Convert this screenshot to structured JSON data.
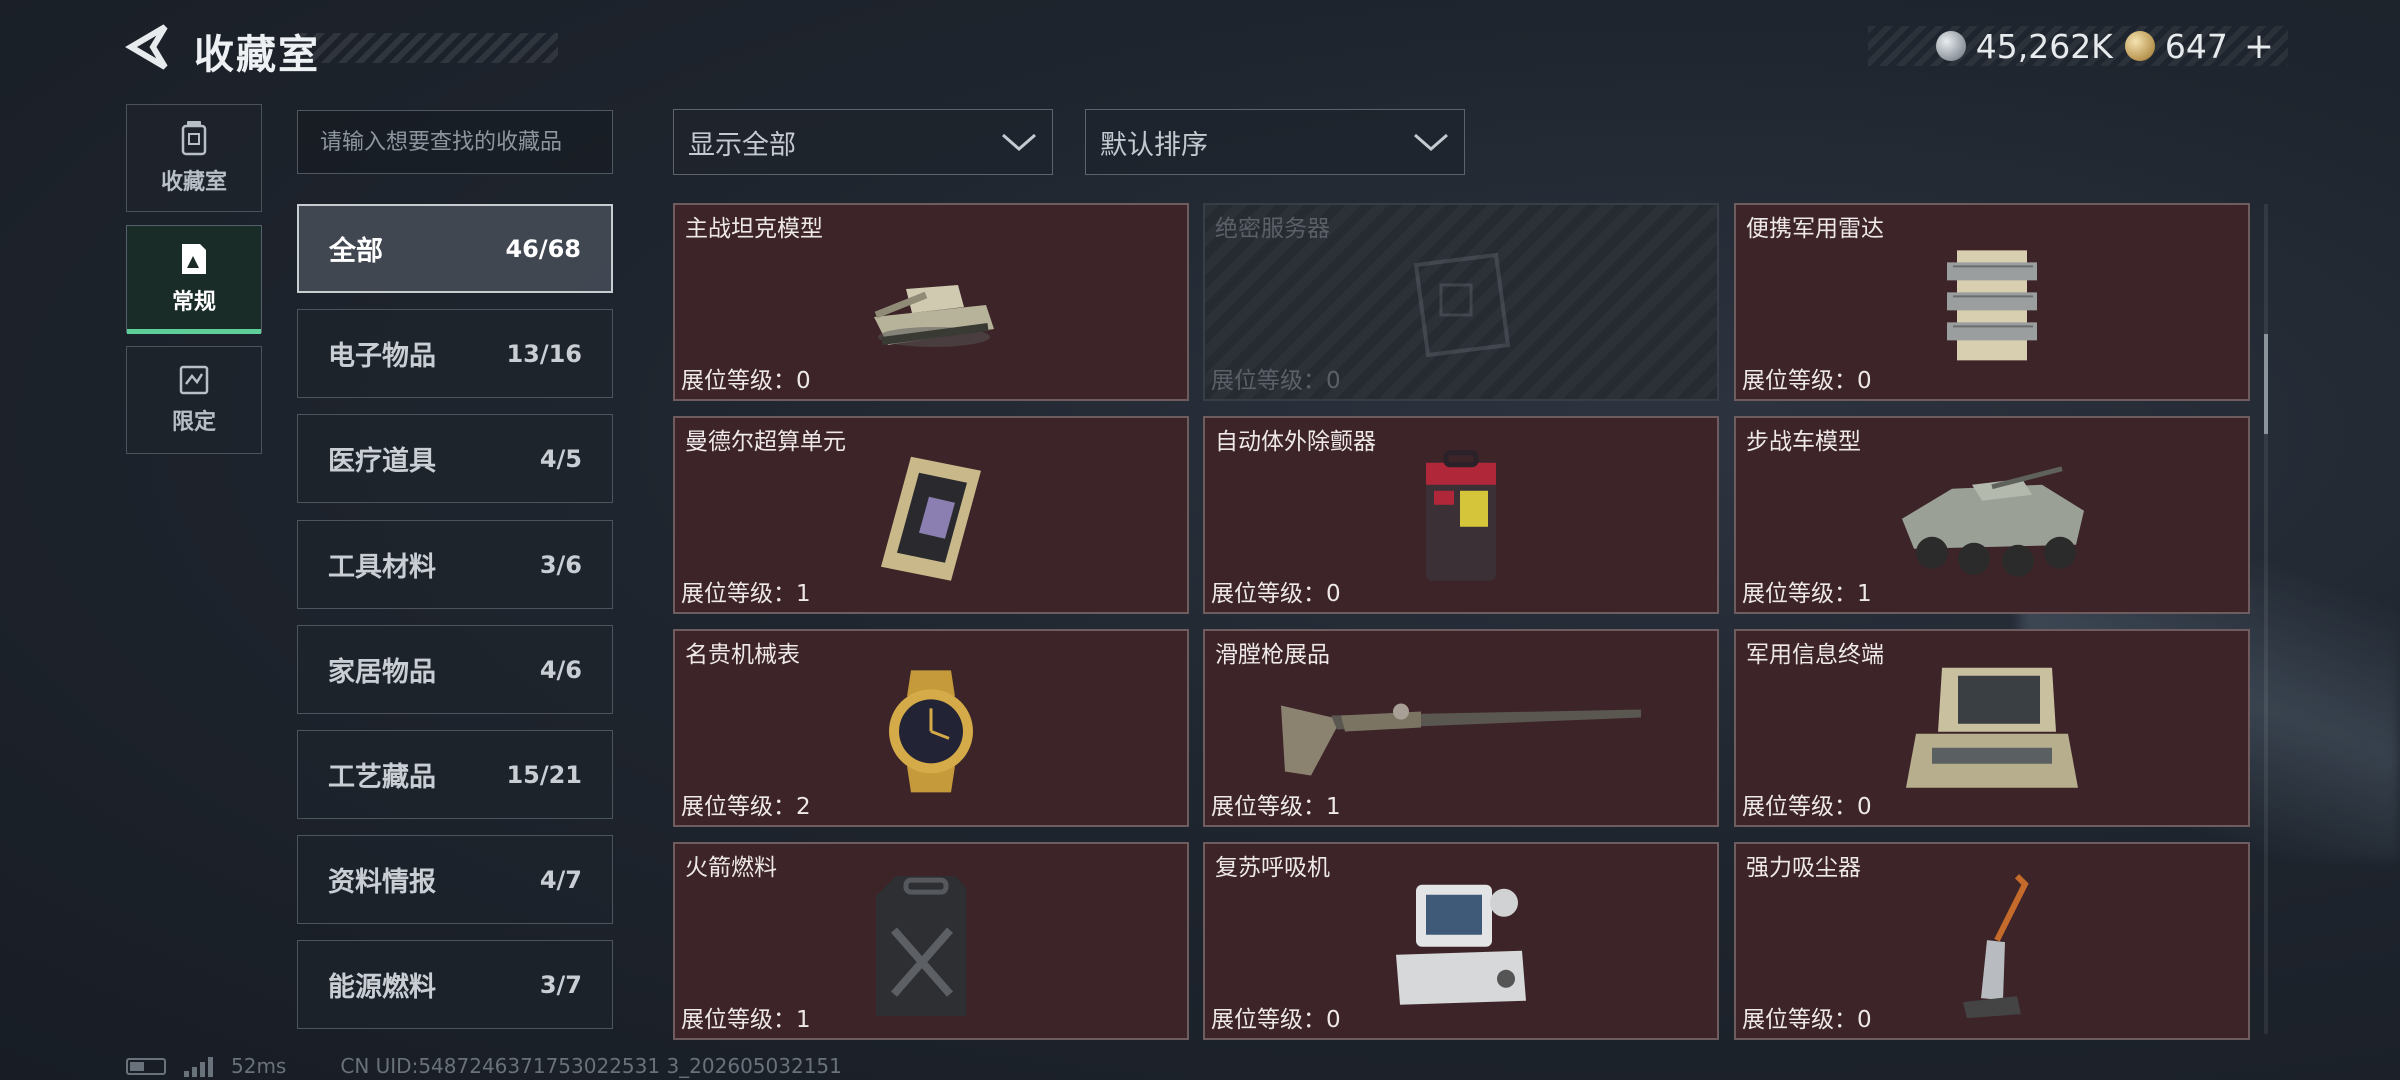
{
  "header": {
    "title": "收藏室",
    "currencies": [
      {
        "icon": "silver-coin-icon",
        "value": "45,262K"
      },
      {
        "icon": "gold-coin-icon",
        "value": "647"
      }
    ],
    "plus": "+"
  },
  "rail": [
    {
      "label": "收藏室",
      "icon": "collection-room-icon",
      "active": false
    },
    {
      "label": "常规",
      "icon": "regular-collection-icon",
      "active": true
    },
    {
      "label": "限定",
      "icon": "limited-collection-icon",
      "active": false
    }
  ],
  "search": {
    "placeholder": "请输入想要查找的收藏品"
  },
  "categories": [
    {
      "name": "全部",
      "count": "46/68",
      "active": true
    },
    {
      "name": "电子物品",
      "count": "13/16"
    },
    {
      "name": "医疗道具",
      "count": "4/5"
    },
    {
      "name": "工具材料",
      "count": "3/6"
    },
    {
      "name": "家居物品",
      "count": "4/6"
    },
    {
      "name": "工艺藏品",
      "count": "15/21"
    },
    {
      "name": "资料情报",
      "count": "4/7"
    },
    {
      "name": "能源燃料",
      "count": "3/7"
    }
  ],
  "filters": {
    "show": "显示全部",
    "sort": "默认排序"
  },
  "items": [
    {
      "name": "主战坦克模型",
      "level": "展位等级：0",
      "art": "tank-model-icon"
    },
    {
      "name": "绝密服务器",
      "level": "展位等级：0",
      "art": "server-icon",
      "locked": true
    },
    {
      "name": "便携军用雷达",
      "level": "展位等级：0",
      "art": "radar-icon"
    },
    {
      "name": "曼德尔超算单元",
      "level": "展位等级：1",
      "art": "compute-unit-icon"
    },
    {
      "name": "自动体外除颤器",
      "level": "展位等级：0",
      "art": "defibrillator-icon"
    },
    {
      "name": "步战车模型",
      "level": "展位等级：1",
      "art": "ifv-model-icon"
    },
    {
      "name": "名贵机械表",
      "level": "展位等级：2",
      "art": "watch-icon"
    },
    {
      "name": "滑膛枪展品",
      "level": "展位等级：1",
      "art": "musket-icon"
    },
    {
      "name": "军用信息终端",
      "level": "展位等级：0",
      "art": "terminal-icon"
    },
    {
      "name": "火箭燃料",
      "level": "展位等级：1",
      "art": "fuel-can-icon"
    },
    {
      "name": "复苏呼吸机",
      "level": "展位等级：0",
      "art": "ventilator-icon"
    },
    {
      "name": "强力吸尘器",
      "level": "展位等级：0",
      "art": "vacuum-icon"
    }
  ],
  "footer": {
    "ping": "52ms",
    "uid": "CN UID:5487246371753022531 3_202605032151"
  }
}
